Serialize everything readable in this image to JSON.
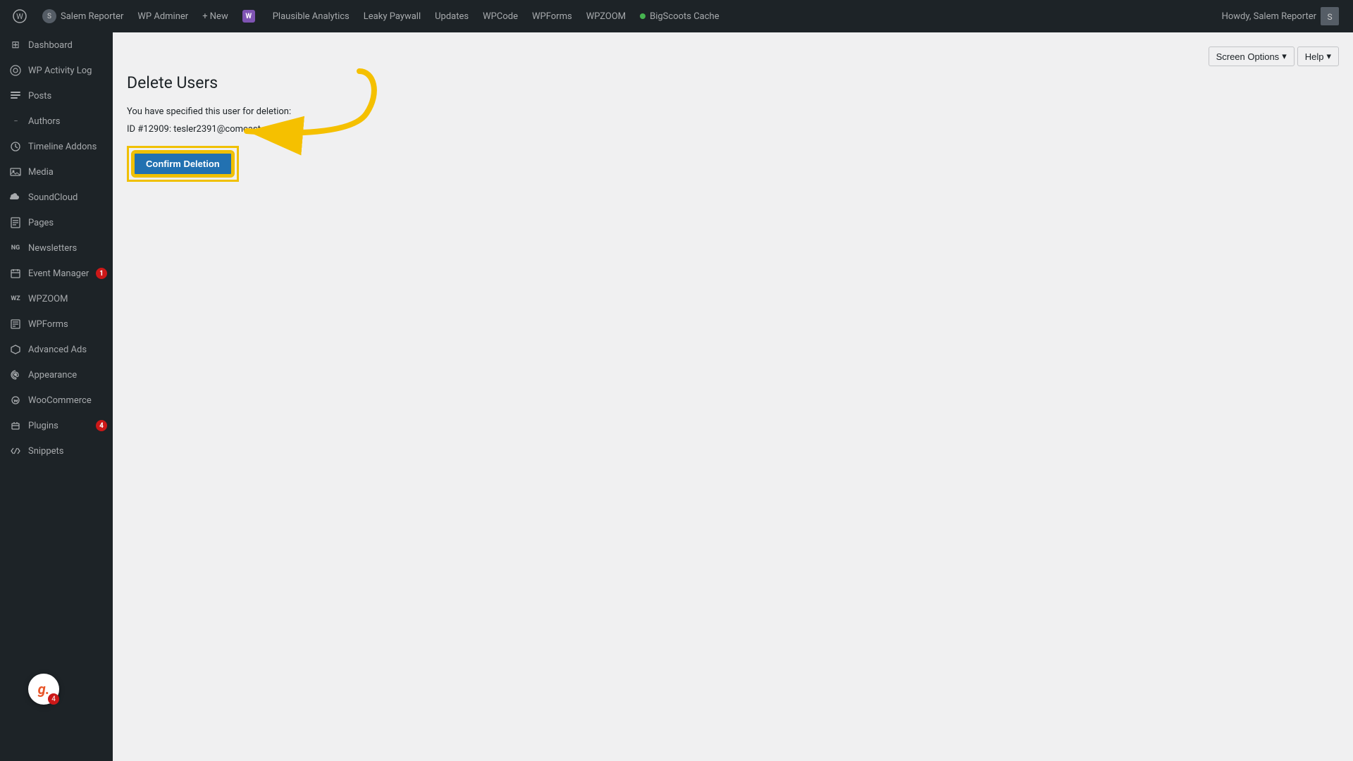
{
  "adminbar": {
    "wp_logo": "⊕",
    "site_name": "Salem Reporter",
    "wp_adminer": "WP Adminer",
    "new_label": "+ New",
    "woo_icon": "W",
    "plausible": "Plausible Analytics",
    "leaky_paywall": "Leaky Paywall",
    "updates": "Updates",
    "wpcode": "WPCode",
    "wpforms": "WPForms",
    "wpzoom": "WPZOOM",
    "bigscoots": "BigScoots Cache",
    "howdy": "Howdy, Salem Reporter"
  },
  "sidebar": {
    "items": [
      {
        "id": "dashboard",
        "icon": "⊞",
        "label": "Dashboard"
      },
      {
        "id": "activity-log",
        "icon": "👁",
        "label": "WP Activity Log"
      },
      {
        "id": "posts",
        "icon": "📝",
        "label": "Posts"
      },
      {
        "id": "authors",
        "icon": "···",
        "label": "Authors"
      },
      {
        "id": "timeline",
        "icon": "⚙",
        "label": "Timeline Addons"
      },
      {
        "id": "media",
        "icon": "🖼",
        "label": "Media"
      },
      {
        "id": "soundcloud",
        "icon": "☁",
        "label": "SoundCloud"
      },
      {
        "id": "pages",
        "icon": "📄",
        "label": "Pages"
      },
      {
        "id": "newsletters",
        "icon": "NG",
        "label": "Newsletters"
      },
      {
        "id": "event-manager",
        "icon": "📅",
        "label": "Event Manager",
        "badge": "1"
      },
      {
        "id": "wpzoom",
        "icon": "WZ",
        "label": "WPZOOM"
      },
      {
        "id": "wpforms",
        "icon": "☰",
        "label": "WPForms"
      },
      {
        "id": "advanced-ads",
        "icon": "⬡",
        "label": "Advanced Ads"
      },
      {
        "id": "appearance",
        "icon": "🎨",
        "label": "Appearance"
      },
      {
        "id": "woocommerce",
        "icon": "🛒",
        "label": "WooCommerce"
      },
      {
        "id": "plugins",
        "icon": "🔌",
        "label": "Plugins",
        "badge": "4"
      },
      {
        "id": "snippets",
        "icon": "✂",
        "label": "Snippets"
      }
    ]
  },
  "toolbar": {
    "screen_options": "Screen Options",
    "help": "Help"
  },
  "page": {
    "title": "Delete Users",
    "instruction": "You have specified this user for deletion:",
    "user_info": "ID #12909: tesler2391@comcast.net",
    "confirm_btn": "Confirm Deletion"
  },
  "grammarly": {
    "letter": "g.",
    "count": "4"
  }
}
